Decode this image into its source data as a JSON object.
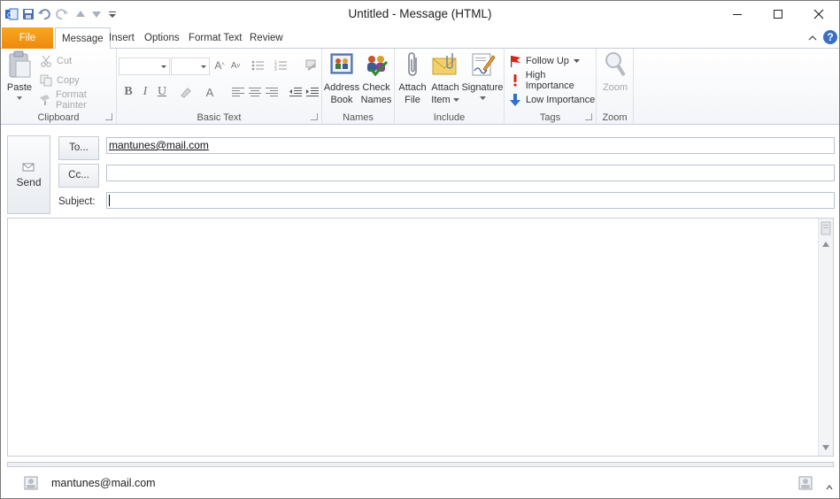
{
  "window": {
    "title": "Untitled",
    "title_sep": "-",
    "title_suffix": "Message (HTML)"
  },
  "tabs": [
    "File",
    "Message",
    "Insert",
    "Options",
    "Format Text",
    "Review"
  ],
  "ribbon": {
    "clipboard": {
      "paste": "Paste",
      "cut": "Cut",
      "copy": "Copy",
      "format_painter": "Format Painter",
      "label": "Clipboard"
    },
    "basic_text": {
      "label": "Basic Text"
    },
    "names": {
      "address_book_1": "Address",
      "address_book_2": "Book",
      "check_names_1": "Check",
      "check_names_2": "Names",
      "label": "Names"
    },
    "include": {
      "attach_file_1": "Attach",
      "attach_file_2": "File",
      "attach_item_1": "Attach",
      "attach_item_2": "Item",
      "signature": "Signature",
      "label": "Include"
    },
    "tags": {
      "follow_up": "Follow Up",
      "high_importance": "High Importance",
      "low_importance": "Low Importance",
      "label": "Tags"
    },
    "zoom": {
      "zoom": "Zoom",
      "label": "Zoom"
    }
  },
  "compose": {
    "send": "Send",
    "to_button": "To...",
    "cc_button": "Cc...",
    "subject_label": "Subject:",
    "to_value": "mantunes@mail.com",
    "cc_value": "",
    "subject_value": ""
  },
  "footer": {
    "contact": "mantunes@mail.com"
  },
  "colors": {
    "file_tab": "#ee8a0a",
    "accent_blue": "#3a6fc4"
  }
}
